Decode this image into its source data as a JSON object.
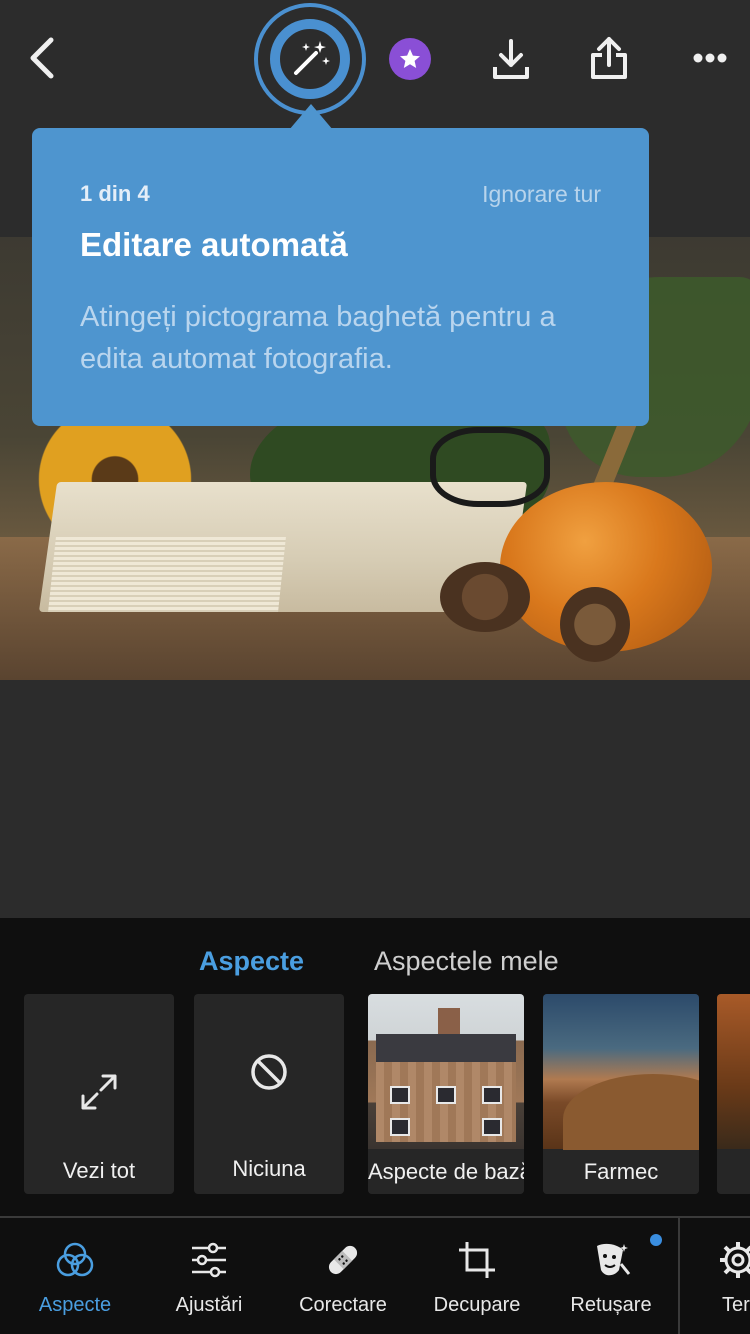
{
  "topbar": {
    "back_icon": "chevron-left-icon",
    "auto_edit_icon": "magic-wand-icon",
    "premium_icon": "star-icon",
    "download_icon": "download-icon",
    "share_icon": "share-icon",
    "more_icon": "more-dots-icon"
  },
  "tooltip": {
    "step": "1 din 4",
    "skip": "Ignorare tur",
    "title": "Editare automată",
    "body": "Atingeți pictograma baghetă pentru a edita automat fotografia."
  },
  "presets": {
    "tabs": [
      {
        "label": "Aspecte",
        "active": true
      },
      {
        "label": "Aspectele mele",
        "active": false
      }
    ],
    "tiles": [
      {
        "label": "Vezi tot",
        "icon": "expand-arrows-icon"
      },
      {
        "label": "Niciuna",
        "icon": "none-circle-icon"
      },
      {
        "label": "Aspecte de bază"
      },
      {
        "label": "Farmec"
      }
    ]
  },
  "toolbar": {
    "items": [
      {
        "label": "Aspecte",
        "icon": "overlapping-circles-icon",
        "active": true
      },
      {
        "label": "Ajustări",
        "icon": "sliders-icon"
      },
      {
        "label": "Corectare",
        "icon": "bandage-icon"
      },
      {
        "label": "Decupare",
        "icon": "crop-icon"
      },
      {
        "label": "Retușare",
        "icon": "face-retouch-icon",
        "badge": true
      },
      {
        "label": "Ter",
        "icon": "gear-icon"
      }
    ]
  },
  "colors": {
    "accent": "#4a9ee0",
    "tooltip_bg": "#4e95cf",
    "premium": "#8a4fd6",
    "background": "#2c2c2c",
    "panel": "#0f0f0f"
  }
}
